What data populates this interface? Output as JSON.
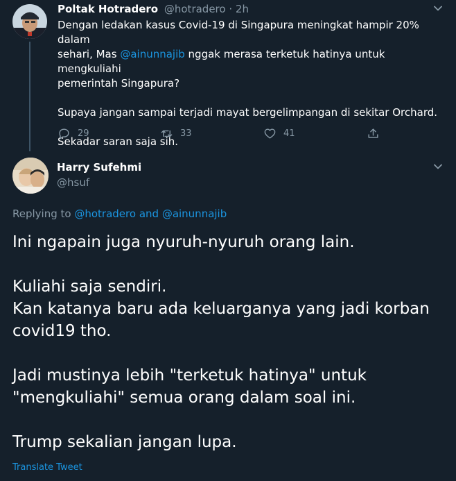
{
  "parent_tweet": {
    "author_name": "Poltak Hotradero",
    "author_handle": "@hotradero",
    "separator": "·",
    "time": "2h",
    "text": {
      "line1": "Dengan ledakan kasus Covid-19 di Singapura meningkat hampir 20% dalam",
      "line2_start": "sehari, Mas ",
      "mention": "@ainunnajib",
      "line2_end": " nggak merasa terketuk hatinya untuk mengkuliahi",
      "line3": "pemerintah Singapura?",
      "para2": "Supaya jangan sampai terjadi mayat bergelimpangan di sekitar Orchard.",
      "para3": "Sekadar saran saja sih."
    },
    "actions": {
      "reply_count": "29",
      "retweet_count": "33",
      "like_count": "41"
    }
  },
  "main_tweet": {
    "author_name": "Harry Sufehmi",
    "author_handle": "@hsuf",
    "replying_to_label": "Replying to ",
    "replying_to_user1": "@hotradero",
    "replying_and": " and ",
    "replying_to_user2": "@ainunnajib",
    "text": {
      "line1": "Ini ngapain juga nyuruh-nyuruh orang lain.",
      "line2": "Kuliahi saja sendiri.",
      "line3": "Kan katanya baru ada keluarganya yang jadi korban",
      "line4": "covid19 tho.",
      "line5": "Jadi mustinya lebih \"terketuk hatinya\" untuk",
      "line6": "\"mengkuliahi\" semua orang dalam soal ini.",
      "line7": "Trump sekalian jangan lupa."
    },
    "translate_label": "Translate Tweet"
  },
  "colors": {
    "background": "#15202b",
    "accent": "#1b95e0",
    "muted": "#8899a6",
    "thread_line": "#3d5466"
  }
}
